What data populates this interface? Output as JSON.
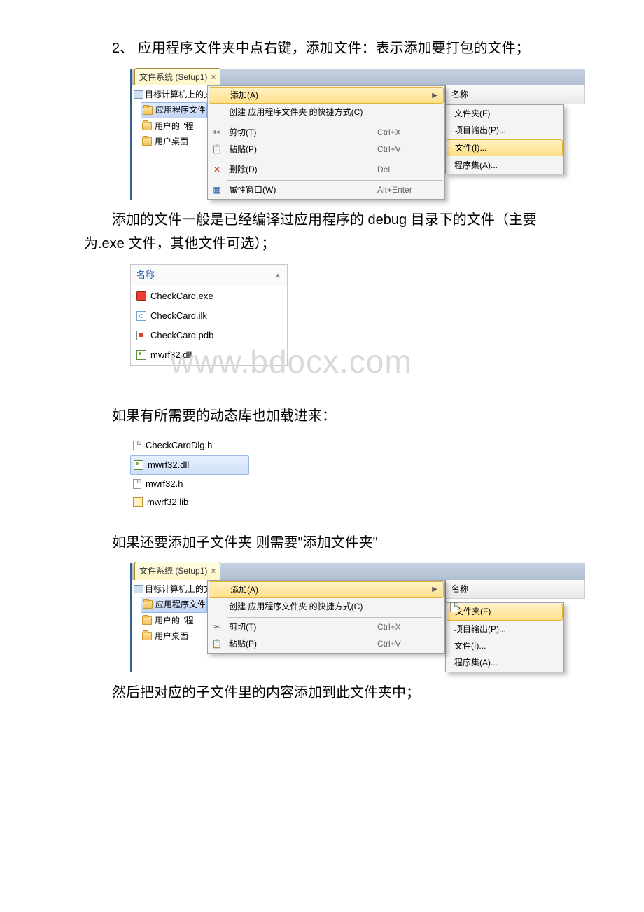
{
  "paragraphs": {
    "p1": "2、 应用程序文件夹中点右键，添加文件：表示添加要打包的文件；",
    "p2": "添加的文件一般是已经编译过应用程序的 debug 目录下的文件（主要为.exe 文件，其他文件可选）；",
    "p3": "如果有所需要的动态库也加载进来：",
    "p4": "如果还要添加子文件夹 则需要\"添加文件夹\"",
    "p5": "然后把对应的子文件里的内容添加到此文件夹中；"
  },
  "tab_title": "文件系统 (Setup1)",
  "tree": {
    "root": "目标计算机上的文件系统",
    "app_folder": "应用程序文件夹",
    "user_prog": "用户的 \"程",
    "user_prog2": "用户的 \"程",
    "user_desktop": "用户桌面"
  },
  "right_header": "名称",
  "trunc_row": "CheckCard.exe",
  "menu": {
    "add": "添加(A)",
    "create_shortcut": "创建 应用程序文件夹 的快捷方式(C)",
    "cut": "剪切(T)",
    "paste": "粘贴(P)",
    "delete": "删除(D)",
    "properties": "属性窗口(W)",
    "sc_cut": "Ctrl+X",
    "sc_paste": "Ctrl+V",
    "sc_del": "Del",
    "sc_prop": "Alt+Enter"
  },
  "submenu": {
    "folder": "文件夹(F)",
    "project_output": "项目输出(P)...",
    "file": "文件(I)...",
    "assembly": "程序集(A)..."
  },
  "filelist": {
    "header": "名称",
    "items": [
      "CheckCard.exe",
      "CheckCard.ilk",
      "CheckCard.pdb",
      "mwrf32.dll"
    ]
  },
  "minilist": {
    "items": [
      "CheckCardDlg.h",
      "mwrf32.dll",
      "mwrf32.h",
      "mwrf32.lib"
    ]
  },
  "watermark": "www.bdocx.com"
}
